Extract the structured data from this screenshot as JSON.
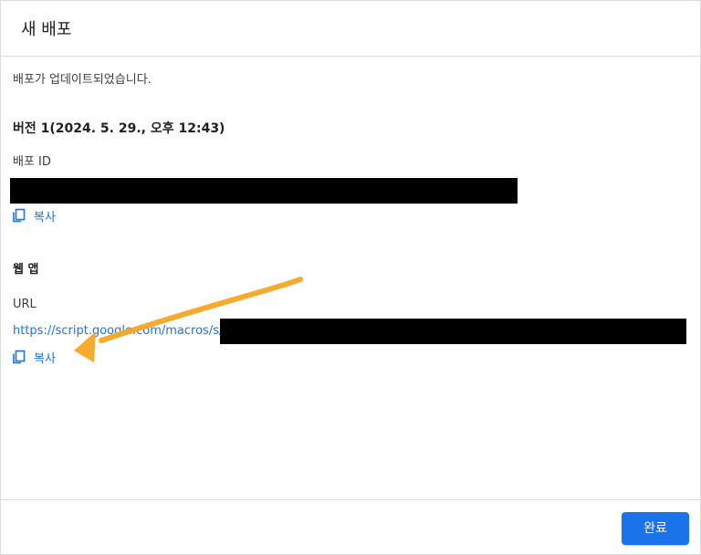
{
  "dialog": {
    "title": "새 배포"
  },
  "status": {
    "message": "배포가 업데이트되었습니다."
  },
  "version": {
    "heading": "버전 1(2024. 5. 29., 오후 12:43)"
  },
  "deployment_id": {
    "label": "배포 ID",
    "copy_label": "복사"
  },
  "web_app": {
    "heading": "웹 앱",
    "url_label": "URL",
    "url_visible_prefix": "https://script.google.com/macros/s/",
    "copy_label": "복사"
  },
  "footer": {
    "done_label": "완료"
  },
  "colors": {
    "accent": "#1a73e8",
    "annotation": "#f5a623",
    "redaction": "#000000"
  },
  "icons": {
    "copy": "copy-icon"
  }
}
